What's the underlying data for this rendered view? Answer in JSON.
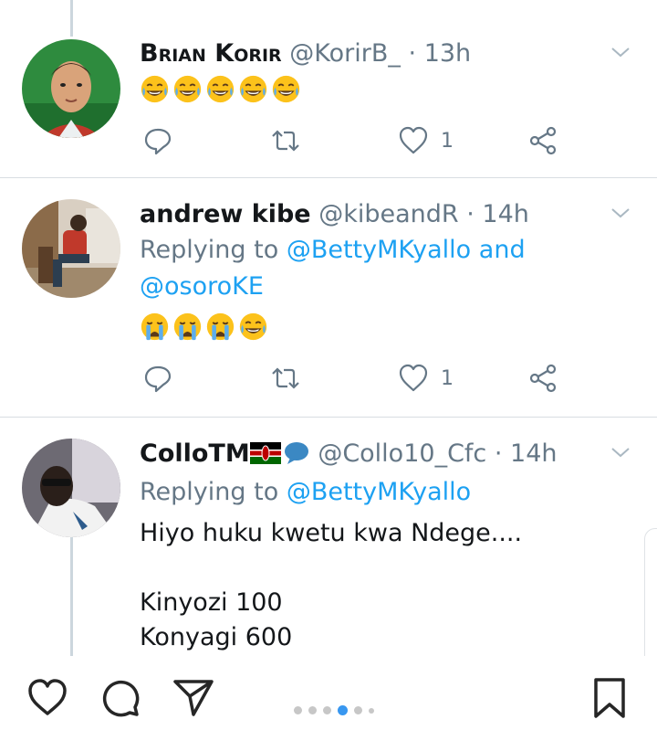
{
  "tweets": [
    {
      "name": "Brian Korir",
      "handle": "@KorirB_",
      "time": "13h",
      "likes": "1",
      "emojis": [
        "joy",
        "joy",
        "joy",
        "joy",
        "joy"
      ]
    },
    {
      "name": "andrew kibe",
      "handle": "@kibeandR",
      "time": "14h",
      "replying_prefix": "Replying to",
      "replying_user1": "@BettyMKyallo",
      "replying_and": "and",
      "replying_user2": "@osoroKE",
      "likes": "1",
      "emojis": [
        "sob",
        "sob",
        "sob",
        "joy"
      ]
    },
    {
      "name": "ColloTM",
      "name_emojis": [
        "kenya-flag",
        "speech-balloon"
      ],
      "handle": "@Collo10_Cfc",
      "time": "14h",
      "replying_prefix": "Replying to",
      "replying_user1": "@BettyMKyallo",
      "body": "Hiyo huku kwetu kwa Ndege....\n\nKinyozi 100\nKonyagi 600"
    }
  ],
  "separator": "·",
  "icons": {
    "reply": "reply-icon",
    "retweet": "retweet-icon",
    "like": "heart-icon",
    "share": "share-icon",
    "caret": "chevron-down-icon"
  },
  "bottom_bar": {
    "icons": [
      "heart-icon",
      "comment-icon",
      "send-icon",
      "bookmark-icon"
    ],
    "carousel_dots": 6,
    "active_dot": 4
  },
  "colors": {
    "accent": "#1da1f2",
    "secondary_text": "#657786",
    "active_dot": "#3897f0"
  }
}
